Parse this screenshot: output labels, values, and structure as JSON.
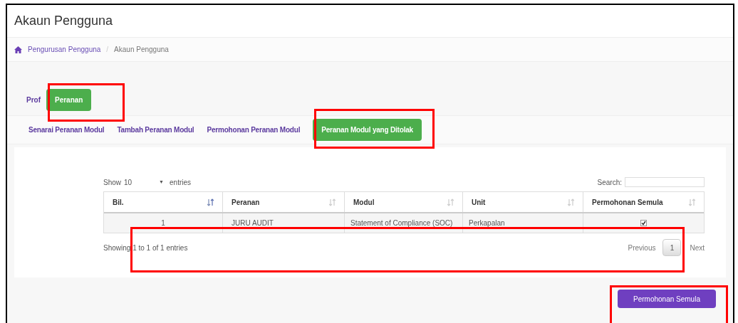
{
  "page_title": "Akaun Pengguna",
  "breadcrumb": [
    "Pengurusan Pengguna",
    "Akaun Pengguna"
  ],
  "breadcrumb_separator": "/",
  "primary_tabs": [
    {
      "label": "Prof",
      "selected": false
    },
    {
      "label": "Peranan",
      "selected": true
    }
  ],
  "secondary_tabs": [
    {
      "label": "Senarai Peranan Modul",
      "selected": false
    },
    {
      "label": "Tambah Peranan Modul",
      "selected": false
    },
    {
      "label": "Permohonan Peranan Modul",
      "selected": false
    },
    {
      "label": "Peranan Modul yang Ditolak",
      "selected": true
    }
  ],
  "table": {
    "show_label": "Show",
    "page_length": "10",
    "select_caret": "▼",
    "entries_label": "entries",
    "search_label": "Search:",
    "columns": [
      "Bil.",
      "Peranan",
      "Modul",
      "Unit",
      "Permohonan Semula"
    ],
    "rows": [
      {
        "bil": "1",
        "peranan": "JURU AUDIT",
        "modul": "Statement of Compliance (SOC)",
        "unit": "Perkapalan",
        "checked": true
      }
    ],
    "info": "Showing 1 to 1 of 1 entries",
    "previous": "Previous",
    "pages": [
      {
        "label": "1",
        "selected": true
      }
    ],
    "next": "Next"
  },
  "action_button": "Permohonan Semula"
}
